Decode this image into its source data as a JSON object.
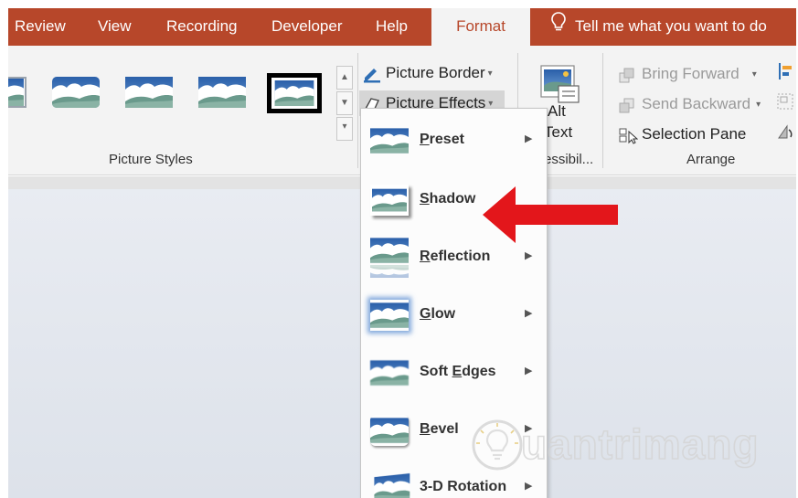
{
  "tabs": [
    {
      "label": "Review",
      "active": false
    },
    {
      "label": "View",
      "active": false
    },
    {
      "label": "Recording",
      "active": false
    },
    {
      "label": "Developer",
      "active": false
    },
    {
      "label": "Help",
      "active": false
    },
    {
      "label": "Format",
      "active": true
    }
  ],
  "tell_me": {
    "label": "Tell me what you want to do",
    "icon": "lightbulb-icon"
  },
  "ribbon": {
    "picture_styles": {
      "label": "Picture Styles"
    },
    "picture_border": {
      "label": "Picture Border",
      "icon": "pen-icon"
    },
    "picture_effects": {
      "label": "Picture Effects",
      "icon": "eraser-effects-icon"
    },
    "alt_text": {
      "line1": "Alt",
      "line2": "Text",
      "group_label": "essibil..."
    },
    "arrange": {
      "label": "Arrange",
      "bring_forward": "Bring Forward",
      "send_backward": "Send Backward",
      "selection_pane": "Selection Pane"
    }
  },
  "effects_menu": {
    "items": [
      {
        "pre": "",
        "ul": "P",
        "post": "reset"
      },
      {
        "pre": "",
        "ul": "S",
        "post": "hadow"
      },
      {
        "pre": "",
        "ul": "R",
        "post": "eflection"
      },
      {
        "pre": "",
        "ul": "G",
        "post": "low"
      },
      {
        "pre": "Soft ",
        "ul": "E",
        "post": "dges"
      },
      {
        "pre": "",
        "ul": "B",
        "post": "evel"
      },
      {
        "pre": "3-D Rotation",
        "ul": "",
        "post": ""
      }
    ]
  },
  "watermark": {
    "text": "uantrimang"
  },
  "colors": {
    "tab_bar": "#b7472a",
    "ribbon": "#f3f3f3",
    "arrow": "#e3161b",
    "thumb_sky": "#2e67b2",
    "thumb_hill": "#7fa9a0"
  }
}
